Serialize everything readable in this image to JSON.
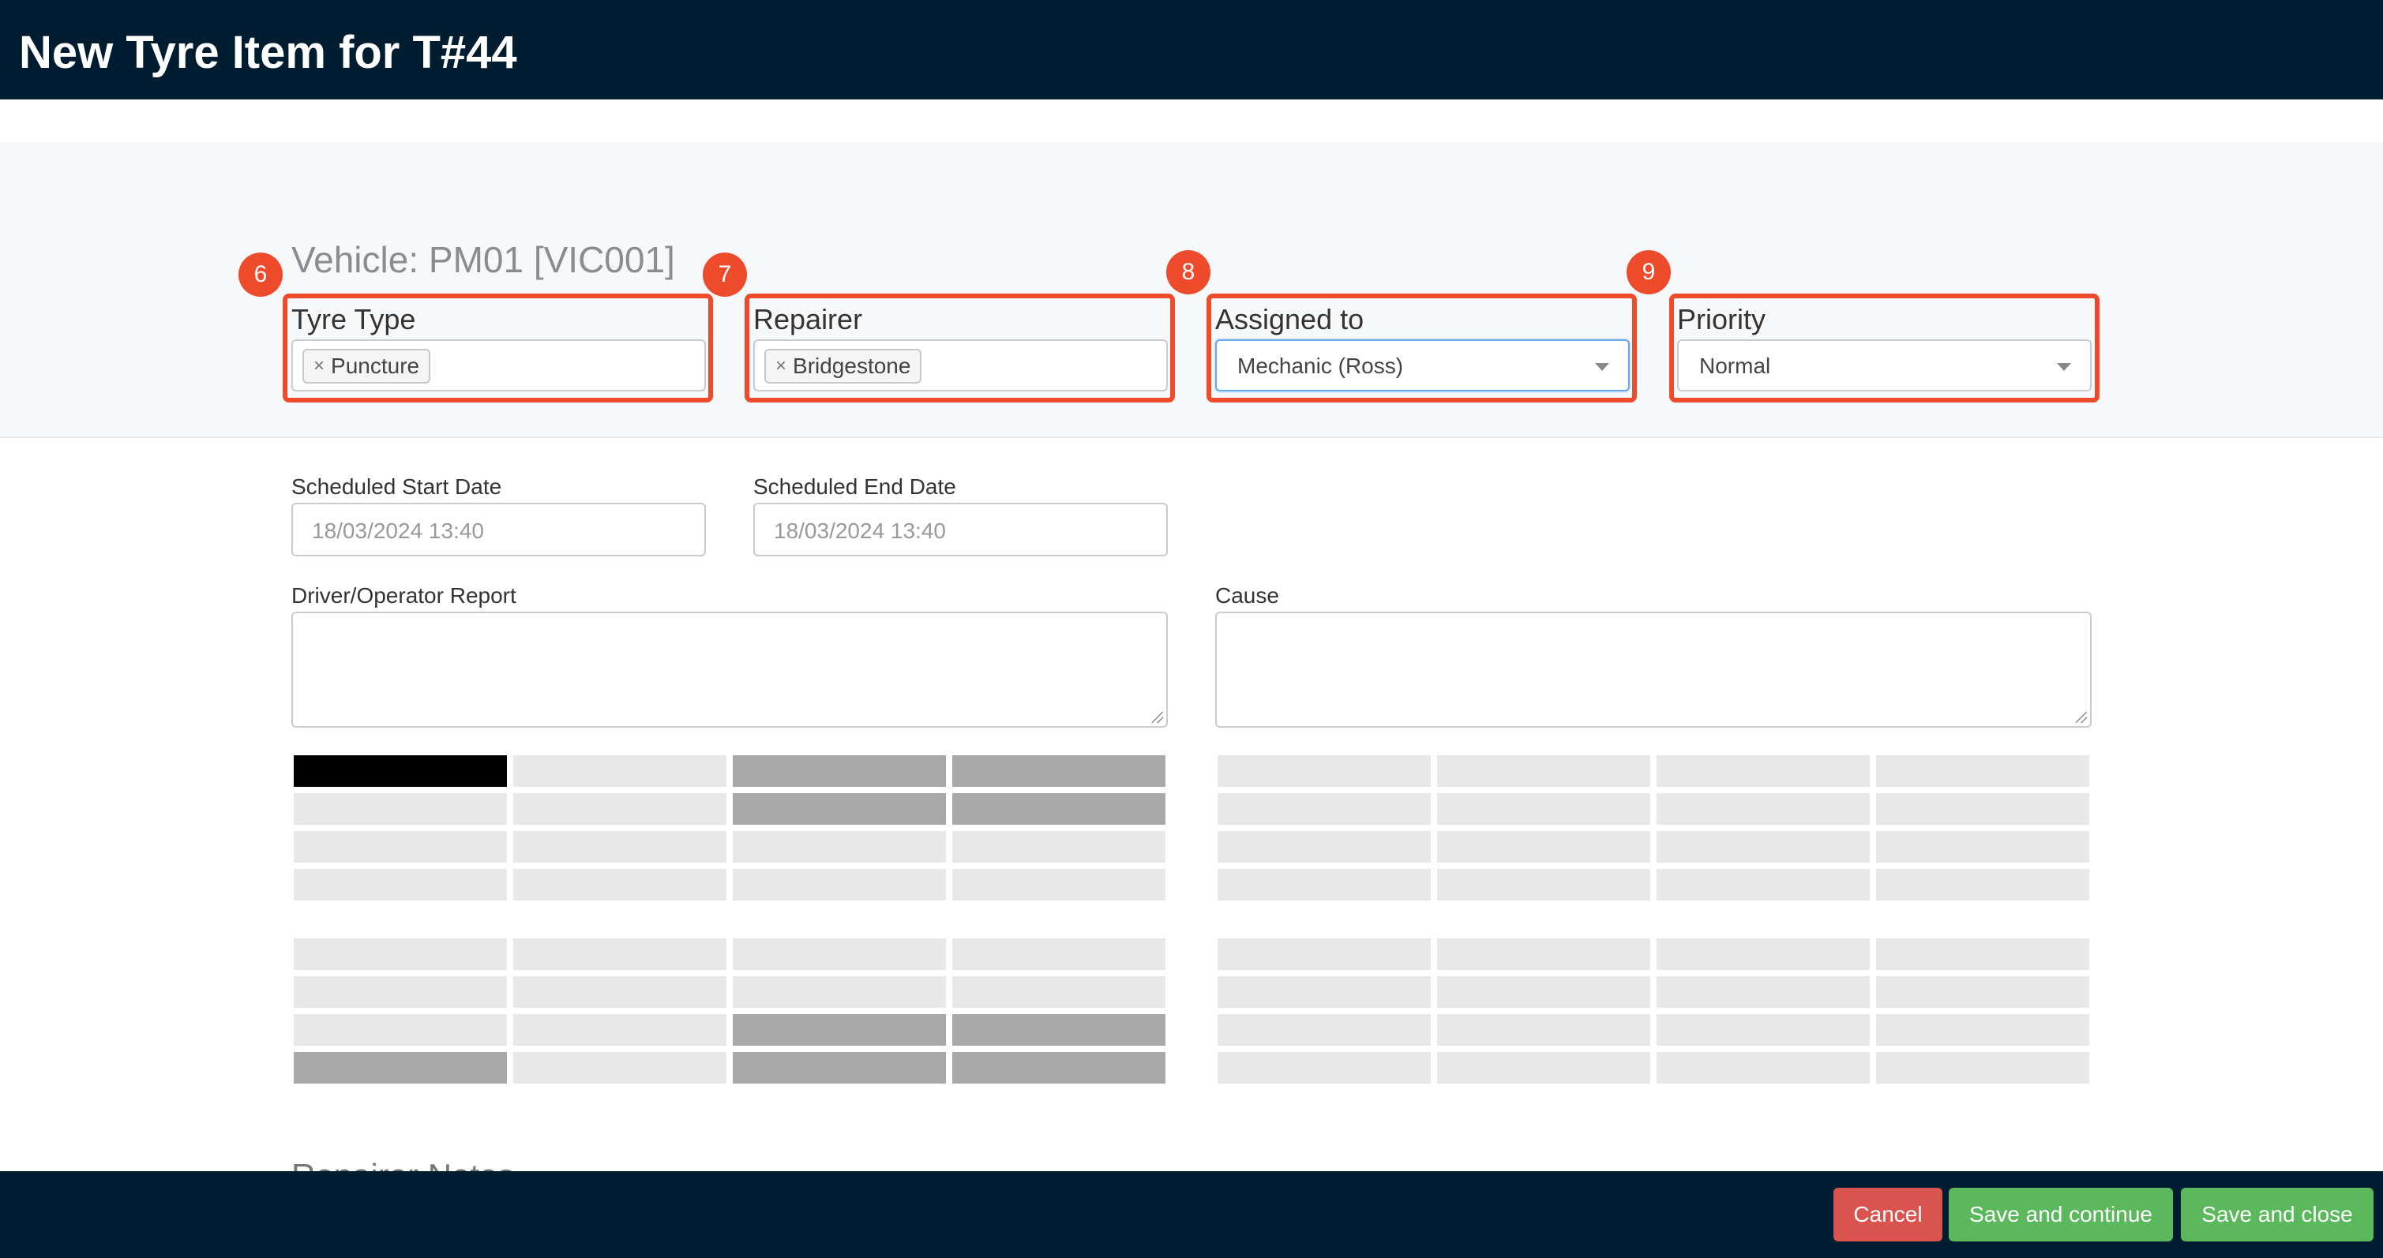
{
  "header": {
    "title": "New Tyre Item for T#44"
  },
  "vehicle_label": "Vehicle: PM01 [VIC001]",
  "fields": {
    "tyre_type": {
      "badge": "6",
      "label": "Tyre Type",
      "tag": "Puncture",
      "remove": "×"
    },
    "repairer": {
      "badge": "7",
      "label": "Repairer",
      "tag": "Bridgestone",
      "remove": "×"
    },
    "assigned_to": {
      "badge": "8",
      "label": "Assigned to",
      "value": "Mechanic (Ross)"
    },
    "priority": {
      "badge": "9",
      "label": "Priority",
      "value": "Normal"
    },
    "scheduled_start": {
      "label": "Scheduled Start Date",
      "placeholder": "18/03/2024 13:40"
    },
    "scheduled_end": {
      "label": "Scheduled End Date",
      "placeholder": "18/03/2024 13:40"
    },
    "driver_report": {
      "label": "Driver/Operator Report",
      "value": ""
    },
    "cause": {
      "label": "Cause",
      "value": ""
    }
  },
  "cut_off_heading": "Repairer Notes",
  "footer": {
    "cancel_label": "Cancel",
    "save_continue_label": "Save and continue",
    "save_close_label": "Save and close"
  },
  "colors": {
    "topbar": "#001c30",
    "highlight": "#ee4a2c",
    "cancel": "#d9534f",
    "save": "#5cb85c"
  }
}
